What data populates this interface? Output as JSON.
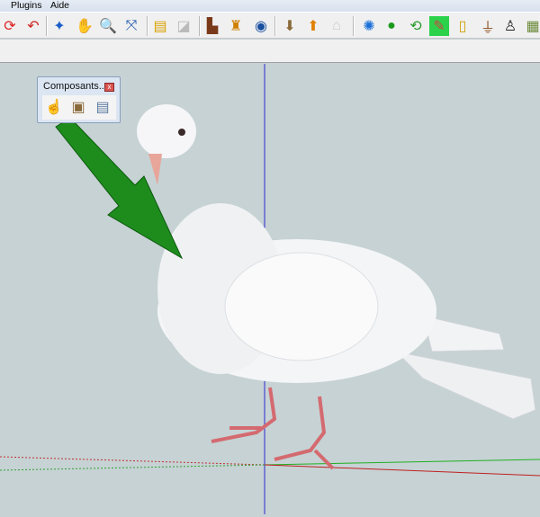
{
  "menu": {
    "items": [
      "Plugins",
      "Aide"
    ]
  },
  "toolbar": {
    "icons": [
      "refresh-icon",
      "walk-back-icon",
      "orbit-icon",
      "pan-icon",
      "zoom-icon",
      "zoom-extents-icon",
      "import-icon",
      "export-icon",
      "terrain-icon",
      "place-model-icon",
      "google-earth-icon",
      "get-models-icon",
      "share-model-icon",
      "share-component-icon",
      "photo-textures-icon",
      "sphere-icon",
      "rotate-icon",
      "paint-icon",
      "clipboard-icon",
      "lamp-icon",
      "brush-icon",
      "components-icon"
    ]
  },
  "components_panel": {
    "title": "Composants...",
    "close": "x",
    "tools": [
      "hand-icon",
      "component-icon",
      "component-browser-icon"
    ]
  },
  "colors": {
    "viewport": "#c6d2d4",
    "axis_blue": "#2020c0",
    "axis_red": "#c02020",
    "axis_green": "#20a020",
    "arrow": "#1a8a1a"
  }
}
